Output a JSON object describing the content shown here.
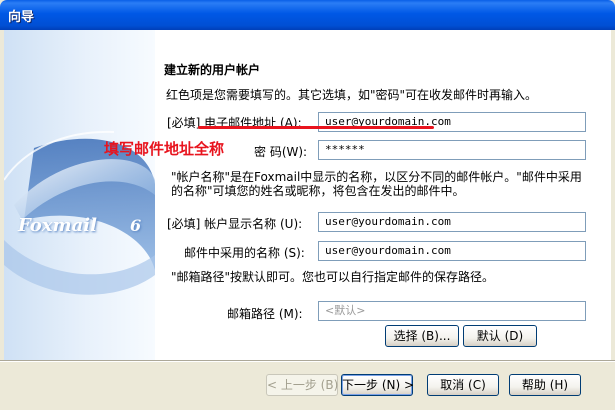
{
  "window": {
    "title": "向导"
  },
  "brand": {
    "logo_text": "Foxmail",
    "logo_version": "6"
  },
  "page": {
    "heading": "建立新的用户帐户",
    "intro": "红色项是您需要填写的。其它选填，如\"密码\"可在收发邮件时再输入。",
    "account_name_note_line1": "\"帐户名称\"是在Foxmail中显示的名称，以区分不同的邮件帐户。\"邮件中采用",
    "account_name_note_line2": "的名称\"可填您的姓名或昵称，将包含在发出的邮件中。",
    "mailbox_path_note": "\"邮箱路径\"按默认即可。您也可以自行指定邮件的保存路径。"
  },
  "form": {
    "email": {
      "label": "[必填] 电子邮件地址 (A):",
      "value": "user@yourdomain.com"
    },
    "password": {
      "label": "密 码(W):",
      "value": "******"
    },
    "display_name": {
      "label": "[必填] 帐户显示名称 (U):",
      "value": "user@yourdomain.com"
    },
    "mail_name": {
      "label": "邮件中采用的名称 (S):",
      "value": "user@yourdomain.com"
    },
    "mailbox_path": {
      "label": "邮箱路径 (M):",
      "placeholder": "<默认>"
    },
    "select_button": "选择 (B)...",
    "default_button": "默认 (D)"
  },
  "annotation": {
    "text": "填写邮件地址全称",
    "color": "#e8141e"
  },
  "footer": {
    "back_button": "< 上一步 (B)",
    "next_button": "下一步 (N) >",
    "cancel_button": "取消 (C)",
    "help_button": "帮助 (H)"
  },
  "colors": {
    "titlebar": "#0058e6",
    "annotation": "#e8141e",
    "input_border": "#7f9db9"
  }
}
